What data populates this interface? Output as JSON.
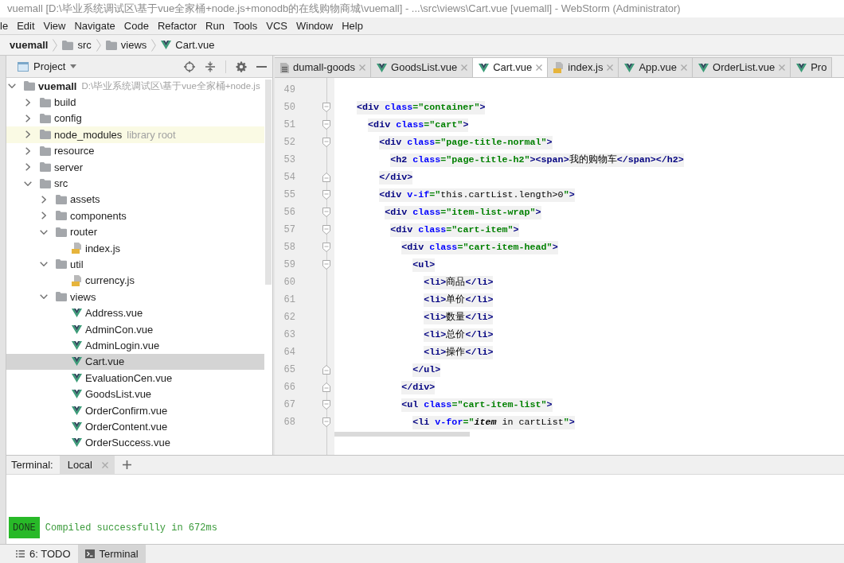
{
  "window": {
    "title": "vuemall [D:\\毕业系统调试区\\基于vue全家桶+node.js+monodb的在线购物商城\\vuemall] - ...\\src\\views\\Cart.vue [vuemall] - WebStorm (Administrator)"
  },
  "menu": [
    "le",
    "Edit",
    "View",
    "Navigate",
    "Code",
    "Refactor",
    "Run",
    "Tools",
    "VCS",
    "Window",
    "Help"
  ],
  "breadcrumbs": [
    {
      "label": "vuemall",
      "kind": "project"
    },
    {
      "label": "src",
      "kind": "folder"
    },
    {
      "label": "views",
      "kind": "folder"
    },
    {
      "label": "Cart.vue",
      "kind": "vue"
    }
  ],
  "project_panel": {
    "title": "Project",
    "tree": [
      {
        "label": "vuemall",
        "kind": "folder",
        "path": "D:\\毕业系统调试区\\基于vue全家桶+node.js",
        "expanded": true,
        "selected": false,
        "children": [
          {
            "label": "build",
            "kind": "folder",
            "expanded": false,
            "selected": false
          },
          {
            "label": "config",
            "kind": "folder",
            "expanded": false,
            "selected": false
          },
          {
            "label": "node_modules",
            "kind": "library",
            "hint": "library root",
            "expanded": false,
            "selected": false
          },
          {
            "label": "resource",
            "kind": "folder",
            "expanded": false,
            "selected": false
          },
          {
            "label": "server",
            "kind": "folder",
            "expanded": false,
            "selected": false
          },
          {
            "label": "src",
            "kind": "folder",
            "expanded": true,
            "selected": false,
            "children": [
              {
                "label": "assets",
                "kind": "folder",
                "expanded": false,
                "selected": false
              },
              {
                "label": "components",
                "kind": "folder",
                "expanded": false,
                "selected": false
              },
              {
                "label": "router",
                "kind": "folder",
                "expanded": true,
                "selected": false,
                "children": [
                  {
                    "label": "index.js",
                    "kind": "js",
                    "selected": false
                  }
                ]
              },
              {
                "label": "util",
                "kind": "folder",
                "expanded": true,
                "selected": false,
                "children": [
                  {
                    "label": "currency.js",
                    "kind": "js",
                    "selected": false
                  }
                ]
              },
              {
                "label": "views",
                "kind": "folder",
                "expanded": true,
                "selected": false,
                "children": [
                  {
                    "label": "Address.vue",
                    "kind": "vue",
                    "selected": false
                  },
                  {
                    "label": "AdminCon.vue",
                    "kind": "vue",
                    "selected": false
                  },
                  {
                    "label": "AdminLogin.vue",
                    "kind": "vue",
                    "selected": false
                  },
                  {
                    "label": "Cart.vue",
                    "kind": "vue",
                    "selected": true
                  },
                  {
                    "label": "EvaluationCen.vue",
                    "kind": "vue",
                    "selected": false
                  },
                  {
                    "label": "GoodsList.vue",
                    "kind": "vue",
                    "selected": false
                  },
                  {
                    "label": "OrderConfirm.vue",
                    "kind": "vue",
                    "selected": false
                  },
                  {
                    "label": "OrderContent.vue",
                    "kind": "vue",
                    "selected": false
                  },
                  {
                    "label": "OrderSuccess.vue",
                    "kind": "vue",
                    "selected": false
                  }
                ]
              }
            ]
          }
        ]
      }
    ]
  },
  "editor_tabs": [
    {
      "label": "dumall-goods",
      "kind": "text",
      "selected": false,
      "closable": true
    },
    {
      "label": "GoodsList.vue",
      "kind": "vue",
      "selected": false,
      "closable": true
    },
    {
      "label": "Cart.vue",
      "kind": "vue",
      "selected": true,
      "closable": true
    },
    {
      "label": "index.js",
      "kind": "js",
      "selected": false,
      "closable": true
    },
    {
      "label": "App.vue",
      "kind": "vue",
      "selected": false,
      "closable": true
    },
    {
      "label": "OrderList.vue",
      "kind": "vue",
      "selected": false,
      "closable": true
    },
    {
      "label": "Pro",
      "kind": "vue",
      "selected": false,
      "closable": false
    }
  ],
  "code": {
    "lines": [
      {
        "number": "49",
        "kind": "plain"
      },
      {
        "number": "50",
        "kind": "opener",
        "tokens": [
          {
            "text": "    <div",
            "kind": "tag"
          },
          {
            "text": " class",
            "kind": "attr"
          },
          {
            "text": "=\"container\"",
            "kind": "value"
          },
          {
            "text": ">",
            "kind": "tag"
          }
        ]
      },
      {
        "number": "51",
        "kind": "opener",
        "tokens": [
          {
            "text": "      <div",
            "kind": "tag"
          },
          {
            "text": " class",
            "kind": "attr"
          },
          {
            "text": "=\"cart\"",
            "kind": "value"
          },
          {
            "text": ">",
            "kind": "tag"
          }
        ]
      },
      {
        "number": "52",
        "kind": "opener",
        "tokens": [
          {
            "text": "        <div",
            "kind": "tag"
          },
          {
            "text": " class",
            "kind": "attr"
          },
          {
            "text": "=\"page-title-normal\"",
            "kind": "value"
          },
          {
            "text": ">",
            "kind": "tag"
          }
        ]
      },
      {
        "number": "53",
        "kind": "plain",
        "tokens": [
          {
            "text": "          <h2",
            "kind": "tag"
          },
          {
            "text": " class",
            "kind": "attr"
          },
          {
            "text": "=\"page-title-h2\"",
            "kind": "value"
          },
          {
            "text": "><span>",
            "kind": "tag"
          },
          {
            "text": "我的购物车",
            "kind": "text"
          },
          {
            "text": "</span></h2>",
            "kind": "tag"
          }
        ]
      },
      {
        "number": "54",
        "kind": "closer",
        "tokens": [
          {
            "text": "        </div>",
            "kind": "tag"
          }
        ]
      },
      {
        "number": "55",
        "kind": "opener",
        "tokens": [
          {
            "text": "        <div",
            "kind": "tag"
          },
          {
            "text": " v-if",
            "kind": "attr"
          },
          {
            "text": "=\"",
            "kind": "value"
          },
          {
            "text": "this.cartList.length>0",
            "kind": "text"
          },
          {
            "text": "\"",
            "kind": "value"
          },
          {
            "text": ">",
            "kind": "tag"
          }
        ]
      },
      {
        "number": "56",
        "kind": "opener",
        "tokens": [
          {
            "text": "         <div",
            "kind": "tag"
          },
          {
            "text": " class",
            "kind": "attr"
          },
          {
            "text": "=\"item-list-wrap\"",
            "kind": "value"
          },
          {
            "text": ">",
            "kind": "tag"
          }
        ]
      },
      {
        "number": "57",
        "kind": "opener",
        "tokens": [
          {
            "text": "          <div",
            "kind": "tag"
          },
          {
            "text": " class",
            "kind": "attr"
          },
          {
            "text": "=\"cart-item\"",
            "kind": "value"
          },
          {
            "text": ">",
            "kind": "tag"
          }
        ]
      },
      {
        "number": "58",
        "kind": "opener",
        "tokens": [
          {
            "text": "            <div",
            "kind": "tag"
          },
          {
            "text": " class",
            "kind": "attr"
          },
          {
            "text": "=\"cart-item-head\"",
            "kind": "value"
          },
          {
            "text": ">",
            "kind": "tag"
          }
        ]
      },
      {
        "number": "59",
        "kind": "opener",
        "tokens": [
          {
            "text": "              <ul>",
            "kind": "tag"
          }
        ]
      },
      {
        "number": "60",
        "kind": "plain",
        "tokens": [
          {
            "text": "                <li>",
            "kind": "tag"
          },
          {
            "text": "商品",
            "kind": "text"
          },
          {
            "text": "</li>",
            "kind": "tag"
          }
        ]
      },
      {
        "number": "61",
        "kind": "plain",
        "tokens": [
          {
            "text": "                <li>",
            "kind": "tag"
          },
          {
            "text": "单价",
            "kind": "text"
          },
          {
            "text": "</li>",
            "kind": "tag"
          }
        ]
      },
      {
        "number": "62",
        "kind": "plain",
        "tokens": [
          {
            "text": "                <li>",
            "kind": "tag"
          },
          {
            "text": "数量",
            "kind": "text"
          },
          {
            "text": "</li>",
            "kind": "tag"
          }
        ]
      },
      {
        "number": "63",
        "kind": "plain",
        "tokens": [
          {
            "text": "                <li>",
            "kind": "tag"
          },
          {
            "text": "总价",
            "kind": "text"
          },
          {
            "text": "</li>",
            "kind": "tag"
          }
        ]
      },
      {
        "number": "64",
        "kind": "plain",
        "tokens": [
          {
            "text": "                <li>",
            "kind": "tag"
          },
          {
            "text": "操作",
            "kind": "text"
          },
          {
            "text": "</li>",
            "kind": "tag"
          }
        ]
      },
      {
        "number": "65",
        "kind": "closer",
        "tokens": [
          {
            "text": "              </ul>",
            "kind": "tag"
          }
        ]
      },
      {
        "number": "66",
        "kind": "closer",
        "tokens": [
          {
            "text": "            </div>",
            "kind": "tag"
          }
        ]
      },
      {
        "number": "67",
        "kind": "opener",
        "tokens": [
          {
            "text": "            <ul",
            "kind": "tag"
          },
          {
            "text": " class",
            "kind": "attr"
          },
          {
            "text": "=\"cart-item-list\"",
            "kind": "value"
          },
          {
            "text": ">",
            "kind": "tag"
          }
        ]
      },
      {
        "number": "68",
        "kind": "opener",
        "tokens": [
          {
            "text": "              <li",
            "kind": "tag"
          },
          {
            "text": " v-for",
            "kind": "attr"
          },
          {
            "text": "=\"",
            "kind": "value"
          },
          {
            "text": "item",
            "kind": "variable"
          },
          {
            "text": " in cartList",
            "kind": "text"
          },
          {
            "text": "\"",
            "kind": "value"
          },
          {
            "text": ">",
            "kind": "tag"
          }
        ]
      }
    ]
  },
  "terminal": {
    "title": "Terminal:",
    "tabs": [
      {
        "label": "Local",
        "selected": true
      }
    ],
    "output": [
      {
        "badge": "DONE",
        "text": "Compiled successfully in 672ms"
      }
    ]
  },
  "tool_buttons": [
    {
      "label": "6: TODO",
      "kind": "todo",
      "selected": false
    },
    {
      "label": "Terminal",
      "kind": "terminal",
      "selected": true
    }
  ]
}
